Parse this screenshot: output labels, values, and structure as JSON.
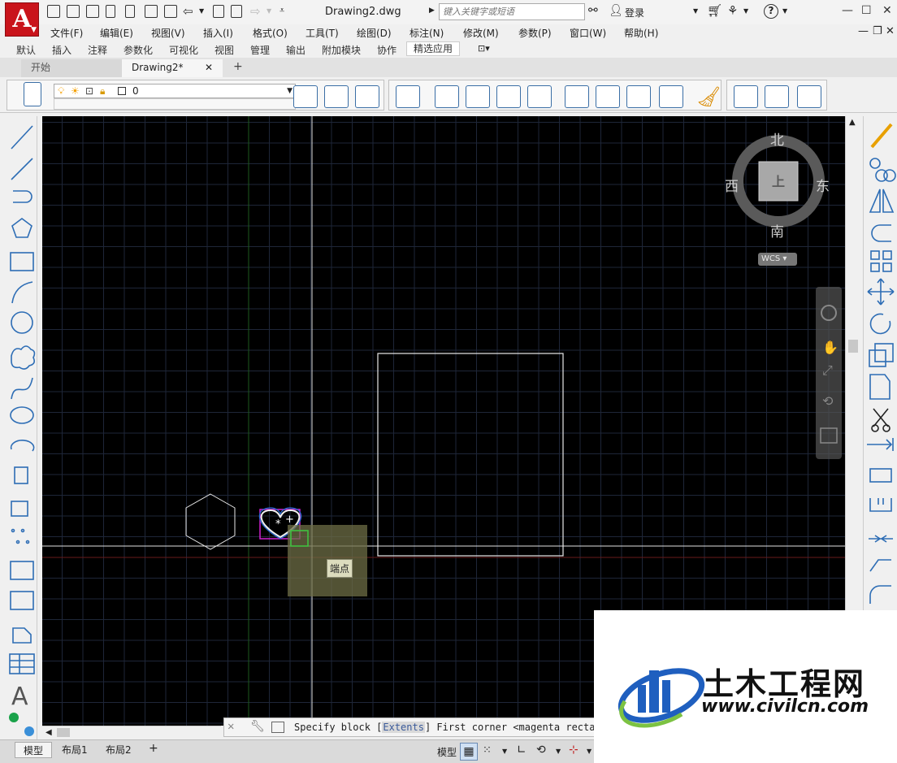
{
  "titlebar": {
    "logo_letter": "A",
    "document_title": "Drawing2.dwg",
    "search_placeholder": "键入关键字或短语",
    "login_label": "登录",
    "help_label": "?",
    "window_buttons": [
      "—",
      "☐",
      "✕"
    ]
  },
  "menubar": {
    "items": [
      "文件(F)",
      "编辑(E)",
      "视图(V)",
      "插入(I)",
      "格式(O)",
      "工具(T)",
      "绘图(D)",
      "标注(N)",
      "修改(M)",
      "参数(P)",
      "窗口(W)",
      "帮助(H)"
    ]
  },
  "ribbon_tabs": {
    "items": [
      "默认",
      "插入",
      "注释",
      "参数化",
      "可视化",
      "视图",
      "管理",
      "输出",
      "附加模块",
      "协作",
      "精选应用"
    ],
    "active": "精选应用"
  },
  "doc_tabs": {
    "start_label": "开始",
    "active_label": "Drawing2*",
    "close_glyph": "✕",
    "add_glyph": "+"
  },
  "layer": {
    "current_layer": "0"
  },
  "compass": {
    "north": "北",
    "south": "南",
    "east": "东",
    "west": "西",
    "center_label": "上",
    "ucs_label": "WCS"
  },
  "canvas": {
    "background_color": "#000000",
    "grid_color": "#1e2638",
    "snap_tooltip": "端点"
  },
  "command_line": {
    "prompt_before": "Specify block [",
    "highlight_option": "Extents",
    "prompt_after": "] First corner <magenta rectang"
  },
  "statusbar": {
    "layout_tabs": [
      "模型",
      "布局1",
      "布局2"
    ],
    "active_layout": "模型",
    "add_glyph": "+",
    "model_label": "模型"
  },
  "watermark": {
    "title": "土木工程网",
    "url": "www.civilcn.com"
  }
}
